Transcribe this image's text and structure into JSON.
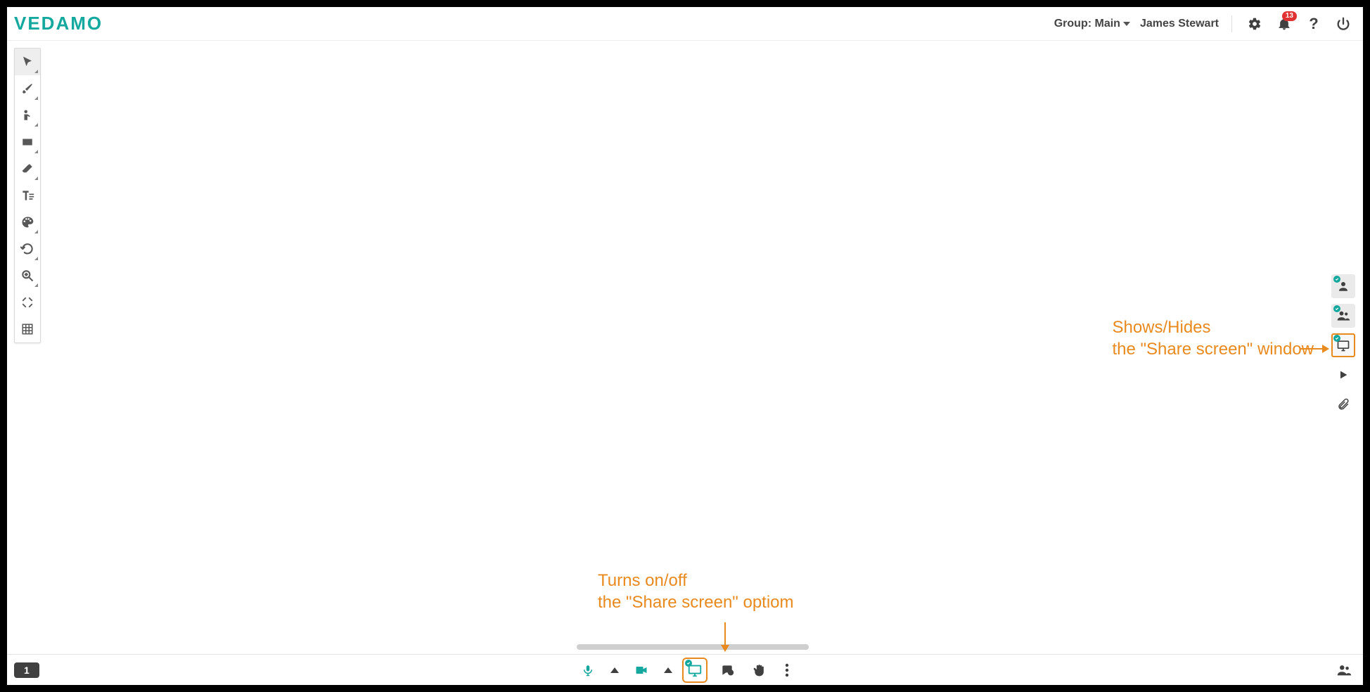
{
  "header": {
    "logo": "VEDAMO",
    "group_label": "Group: Main",
    "user_name": "James Stewart",
    "notifications_count": "13"
  },
  "left_tools": [
    {
      "id": "select-tool",
      "name": "select"
    },
    {
      "id": "brush-tool",
      "name": "brush"
    },
    {
      "id": "pointer-tool",
      "name": "pointer"
    },
    {
      "id": "shape-tool",
      "name": "shape"
    },
    {
      "id": "eraser-tool",
      "name": "eraser"
    },
    {
      "id": "text-tool",
      "name": "text"
    },
    {
      "id": "color-tool",
      "name": "color"
    },
    {
      "id": "undo-tool",
      "name": "undo"
    },
    {
      "id": "zoom-tool",
      "name": "zoom"
    },
    {
      "id": "fullscreen-tool",
      "name": "fullscreen"
    },
    {
      "id": "grid-tool",
      "name": "grid"
    }
  ],
  "right_tools": [
    {
      "id": "camera-panel-toggle",
      "name": "camera-panel"
    },
    {
      "id": "participants-panel-toggle",
      "name": "participants-panel"
    },
    {
      "id": "sharescreen-panel-toggle",
      "name": "share-screen-panel",
      "highlight": true
    },
    {
      "id": "media-panel-toggle",
      "name": "media"
    },
    {
      "id": "attachment-panel-toggle",
      "name": "attachment"
    }
  ],
  "bottom": {
    "page_number": "1",
    "center_controls": [
      {
        "id": "mic-button",
        "name": "mic"
      },
      {
        "id": "mic-options",
        "name": "mic-options"
      },
      {
        "id": "camera-button",
        "name": "camera"
      },
      {
        "id": "camera-options",
        "name": "camera-options"
      },
      {
        "id": "sharescreen-button",
        "name": "share-screen",
        "highlight": true
      },
      {
        "id": "chat-button",
        "name": "chat"
      },
      {
        "id": "raisehand-button",
        "name": "raise-hand"
      },
      {
        "id": "more-button",
        "name": "more"
      }
    ]
  },
  "annotations": {
    "bottom_line1": "Turns on/off",
    "bottom_line2": "the \"Share screen\" optiom",
    "right_line1": "Shows/Hides",
    "right_line2": "the \"Share screen\" window"
  },
  "colors": {
    "brand": "#14a89e",
    "orange": "#e98a1f"
  }
}
